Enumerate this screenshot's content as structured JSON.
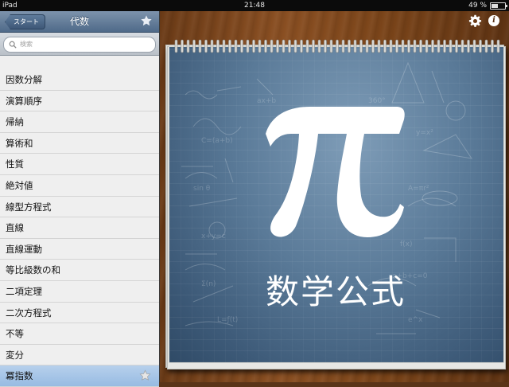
{
  "status_bar": {
    "device": "iPad",
    "time": "21:48",
    "battery": "49 %",
    "battery_level": 0.49
  },
  "navbar": {
    "back_label": "スタート",
    "title": "代数"
  },
  "search": {
    "placeholder": "検索"
  },
  "topics": [
    {
      "label": "因数分解"
    },
    {
      "label": "演算順序"
    },
    {
      "label": "帰納"
    },
    {
      "label": "算術和"
    },
    {
      "label": "性質"
    },
    {
      "label": "絶対値"
    },
    {
      "label": "線型方程式"
    },
    {
      "label": "直線"
    },
    {
      "label": "直線運動"
    },
    {
      "label": "等比級数の和"
    },
    {
      "label": "二項定理"
    },
    {
      "label": "二次方程式"
    },
    {
      "label": "不等"
    },
    {
      "label": "変分"
    },
    {
      "label": "冪指数",
      "selected": true
    }
  ],
  "cover": {
    "symbol": "π",
    "title": "数学公式"
  },
  "icons": {
    "settings": "gear-icon",
    "info": "info-icon",
    "favorite": "star-icon",
    "search": "magnifier-icon"
  },
  "colors": {
    "nav_bar": "#5f7b9b",
    "selected_row": "#a8c6e8",
    "cover_blue": "#4f7090"
  }
}
